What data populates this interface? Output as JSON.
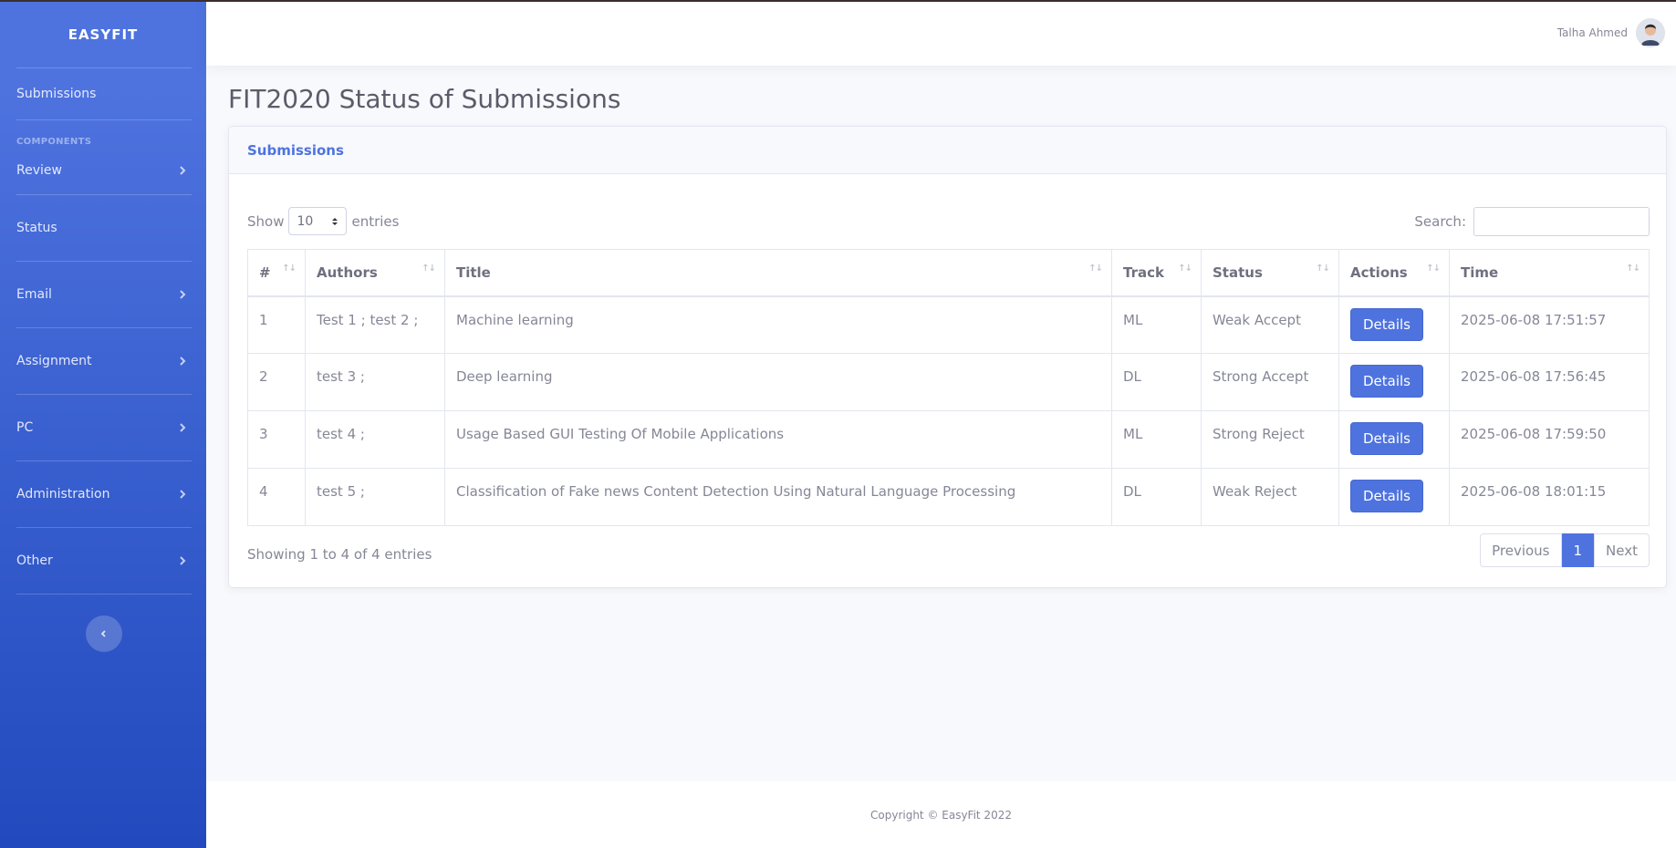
{
  "brand": "EASYFIT",
  "sidebar": {
    "items": [
      {
        "label": "Submissions"
      },
      {
        "label": "Review"
      },
      {
        "label": "Status"
      },
      {
        "label": "Email"
      },
      {
        "label": "Assignment"
      },
      {
        "label": "PC"
      },
      {
        "label": "Administration"
      },
      {
        "label": "Other"
      }
    ],
    "heading": "COMPONENTS"
  },
  "user": {
    "name": "Talha Ahmed"
  },
  "page_title": "FIT2020 Status of Submissions",
  "card": {
    "header": "Submissions",
    "show_label": "Show",
    "entries_label": "entries",
    "page_length": "10",
    "search_label": "Search:",
    "search_value": ""
  },
  "table": {
    "headers": [
      "#",
      "Authors",
      "Title",
      "Track",
      "Status",
      "Actions",
      "Time"
    ],
    "rows": [
      {
        "num": "1",
        "authors": "Test 1 ; test 2 ;",
        "title": "Machine learning",
        "track": "ML",
        "status": "Weak Accept",
        "action": "Details",
        "time": "2025-06-08 17:51:57"
      },
      {
        "num": "2",
        "authors": "test 3 ;",
        "title": "Deep learning",
        "track": "DL",
        "status": "Strong Accept",
        "action": "Details",
        "time": "2025-06-08 17:56:45"
      },
      {
        "num": "3",
        "authors": "test 4 ;",
        "title": "Usage Based GUI Testing Of Mobile Applications",
        "track": "ML",
        "status": "Strong Reject",
        "action": "Details",
        "time": "2025-06-08 17:59:50"
      },
      {
        "num": "4",
        "authors": "test 5 ;",
        "title": "Classification of Fake news Content Detection Using Natural Language Processing",
        "track": "DL",
        "status": "Weak Reject",
        "action": "Details",
        "time": "2025-06-08 18:01:15"
      }
    ]
  },
  "info": "Showing 1 to 4 of 4 entries",
  "pagination": {
    "previous": "Previous",
    "current": "1",
    "next": "Next"
  },
  "footer": "Copyright © EasyFit 2022",
  "colors": {
    "primary": "#4e73df",
    "sidebar_bottom": "#224abe"
  }
}
